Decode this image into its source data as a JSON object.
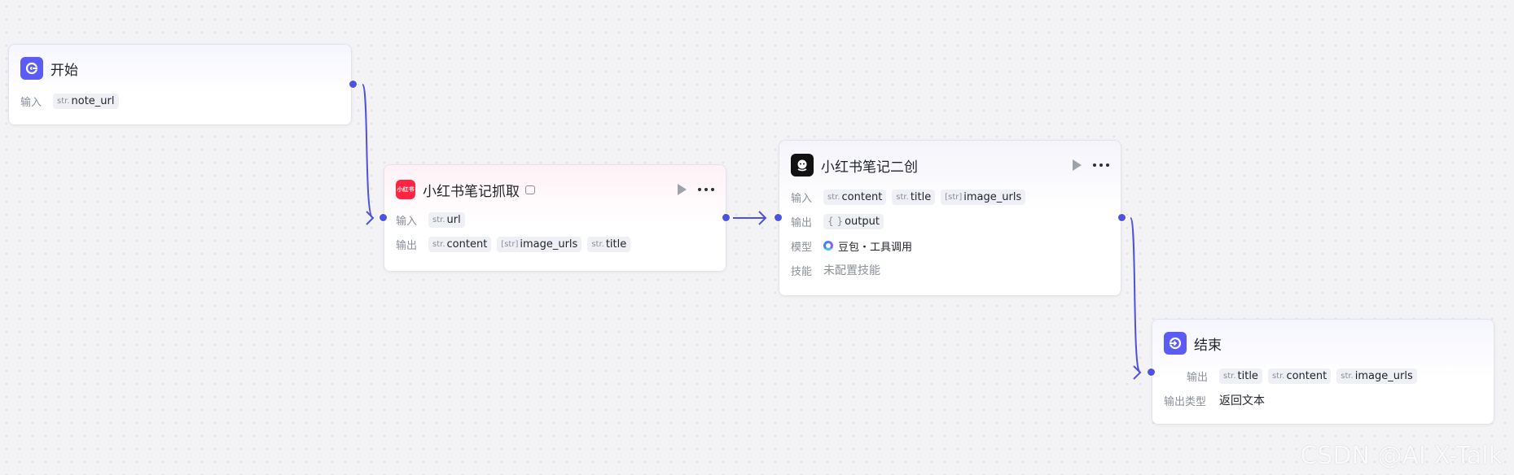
{
  "nodes": {
    "start": {
      "title": "开始",
      "input_label": "输入",
      "inputs": [
        {
          "type": "str.",
          "name": "note_url"
        }
      ]
    },
    "fetch": {
      "title": "小红书笔记抓取",
      "icon_text": "小红书",
      "input_label": "输入",
      "inputs": [
        {
          "type": "str.",
          "name": "url"
        }
      ],
      "output_label": "输出",
      "outputs": [
        {
          "type": "str.",
          "name": "content"
        },
        {
          "type": "[str]",
          "name": "image_urls"
        },
        {
          "type": "str.",
          "name": "title"
        }
      ]
    },
    "rewrite": {
      "title": "小红书笔记二创",
      "input_label": "输入",
      "inputs": [
        {
          "type": "str.",
          "name": "content"
        },
        {
          "type": "str.",
          "name": "title"
        },
        {
          "type": "[str]",
          "name": "image_urls"
        }
      ],
      "output_label": "输出",
      "outputs": [
        {
          "type": "{ }",
          "name": "output"
        }
      ],
      "model_label": "模型",
      "model_value": "豆包・工具调用",
      "skills_label": "技能",
      "skills_value": "未配置技能"
    },
    "end": {
      "title": "结束",
      "output_label": "输出",
      "outputs": [
        {
          "type": "str.",
          "name": "title"
        },
        {
          "type": "str.",
          "name": "content"
        },
        {
          "type": "str.",
          "name": "image_urls"
        }
      ],
      "output_type_label": "输出类型",
      "output_type_value": "返回文本"
    }
  },
  "watermark": "CSDN @AI X-Talk",
  "colors": {
    "accent": "#5b5cf6",
    "edge": "#4e52e0",
    "brand_red": "#ff2442"
  },
  "icons": {
    "start": "start-node-icon",
    "fetch": "xiaohongshu-logo-icon",
    "rewrite": "bot-icon",
    "end": "end-node-icon"
  }
}
